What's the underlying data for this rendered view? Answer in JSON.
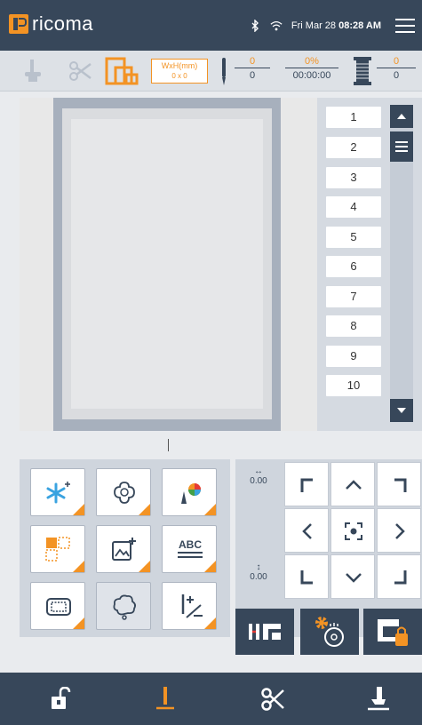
{
  "header": {
    "brand": "ricoma",
    "date": "Fri Mar 28",
    "time": "08:28 AM",
    "icons": [
      "bluetooth-icon",
      "wifi-icon",
      "menu-icon"
    ]
  },
  "info": {
    "size_label": "WxH(mm)",
    "size_value": "0 x 0",
    "stitch_top": "0",
    "stitch_bottom": "0",
    "progress_top": "0%",
    "progress_bottom": "00:00:00",
    "thread_top": "0",
    "thread_bottom": "0"
  },
  "needles": [
    "1",
    "2",
    "3",
    "4",
    "5",
    "6",
    "7",
    "8",
    "9",
    "10"
  ],
  "tools": [
    {
      "name": "add-design-button",
      "icon": "snowflake-plus-icon"
    },
    {
      "name": "design-library-button",
      "icon": "flower-icon"
    },
    {
      "name": "color-button",
      "icon": "thread-color-icon"
    },
    {
      "name": "layout-button",
      "icon": "layout-icon"
    },
    {
      "name": "add-image-button",
      "icon": "image-plus-icon"
    },
    {
      "name": "text-button",
      "icon": "abc-icon"
    },
    {
      "name": "frame-button",
      "icon": "frame-icon"
    },
    {
      "name": "outline-button",
      "icon": "outline-icon"
    },
    {
      "name": "stitch-edit-button",
      "icon": "stitch-edit-icon"
    }
  ],
  "jog": {
    "x_value": "0.00",
    "y_value": "0.00"
  },
  "colors": {
    "accent": "#f39324",
    "dark": "#37475a",
    "panel": "#cfd5dd"
  }
}
